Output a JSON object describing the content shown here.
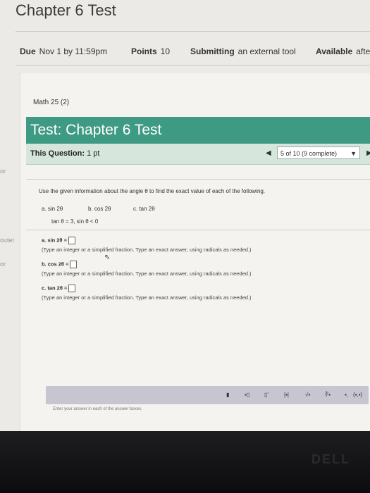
{
  "header": {
    "title": "Chapter 6 Test",
    "due_label": "Due",
    "due_value": "Nov 1 by 11:59pm",
    "points_label": "Points",
    "points_value": "10",
    "submitting_label": "Submitting",
    "submitting_value": "an external tool",
    "available_label": "Available",
    "available_value": "afte"
  },
  "course": "Math 25 (2)",
  "test_title": "Test: Chapter 6 Test",
  "question_bar": {
    "label": "This Question:",
    "points": "1 pt",
    "progress": "5 of 10 (9 complete)"
  },
  "question": {
    "instruction": "Use the given information about the angle θ to find the exact value of each of the following.",
    "parts": [
      "a. sin 2θ",
      "b. cos 2θ",
      "c. tan 2θ"
    ],
    "given": "tan θ = 3, sin θ < 0",
    "answers": [
      {
        "label": "a. sin 2θ =",
        "note": "(Type an integer or a simplified fraction. Type an exact answer, using radicals as needed.)"
      },
      {
        "label": "b. cos 2θ =",
        "note": "(Type an integer or a simplified fraction. Type an exact answer, using radicals as needed.)"
      },
      {
        "label": "c. tan 2θ =",
        "note": "(Type an integer or a simplified fraction. Type an exact answer, using radicals as needed.)"
      }
    ]
  },
  "toolbar": {
    "tools": [
      "▮",
      "▪▯",
      "▯'",
      "|▪|",
      "√▪",
      "∛▪",
      "▪,",
      "(▪,▪)"
    ],
    "hint": "Enter your answer in each of the answer boxes."
  },
  "sidebar_fragments": [
    "or",
    "outer",
    "or"
  ],
  "brand": "DELL",
  "colors": {
    "banner": "#3e9a83",
    "question_bar": "#d6e6dd"
  }
}
